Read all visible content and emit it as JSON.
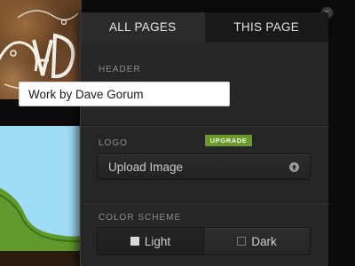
{
  "panel": {
    "tabs": [
      {
        "label": "ALL PAGES",
        "active": true
      },
      {
        "label": "THIS PAGE",
        "active": false
      }
    ],
    "close_icon": "close-icon",
    "header": {
      "label": "HEADER",
      "value": "Work by Dave Gorum"
    },
    "logo": {
      "label": "LOGO",
      "badge": "UPGRADE",
      "upload_label": "Upload Image",
      "upload_icon": "upload-arrow-icon"
    },
    "color_scheme": {
      "label": "COLOR SCHEME",
      "options": [
        {
          "label": "Light",
          "selected": true
        },
        {
          "label": "Dark",
          "selected": false
        }
      ]
    }
  },
  "colors": {
    "panel_bg": "#262626",
    "badge_green": "#6a9a2a",
    "sky": "#9fdcf6",
    "hill": "#5f9a2c"
  }
}
